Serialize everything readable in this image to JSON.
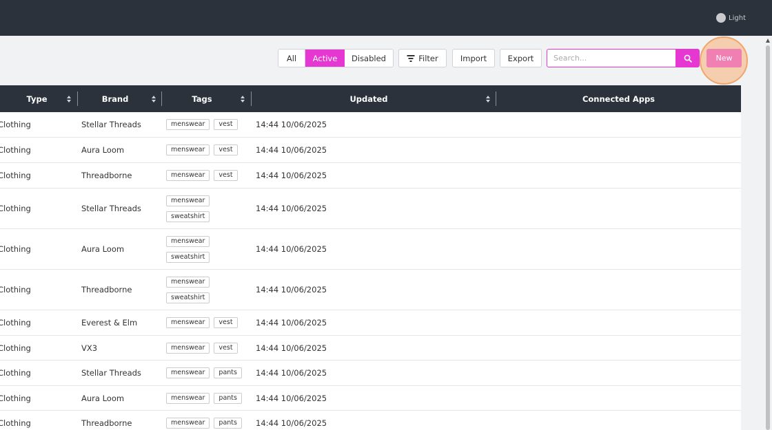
{
  "topbar": {
    "theme_label": "Light"
  },
  "toolbar": {
    "all_label": "All",
    "active_label": "Active",
    "disabled_label": "Disabled",
    "filter_label": "Filter",
    "import_label": "Import",
    "export_label": "Export",
    "search_placeholder": "Search...",
    "new_label": "New"
  },
  "colors": {
    "accent": "#e637d3",
    "new_button": "#f07fb2",
    "header_bg": "#2b323b",
    "highlight": "#f1a46a"
  },
  "table": {
    "headers": [
      "Type",
      "Brand",
      "Tags",
      "Updated",
      "Connected Apps"
    ],
    "rows": [
      {
        "type": "Clothing",
        "brand": "Stellar Threads",
        "tags": [
          "menswear",
          "vest"
        ],
        "updated": "14:44 10/06/2025"
      },
      {
        "type": "Clothing",
        "brand": "Aura Loom",
        "tags": [
          "menswear",
          "vest"
        ],
        "updated": "14:44 10/06/2025"
      },
      {
        "type": "Clothing",
        "brand": "Threadborne",
        "tags": [
          "menswear",
          "vest"
        ],
        "updated": "14:44 10/06/2025"
      },
      {
        "type": "Clothing",
        "brand": "Stellar Threads",
        "tags": [
          "menswear",
          "sweatshirt"
        ],
        "updated": "14:44 10/06/2025"
      },
      {
        "type": "Clothing",
        "brand": "Aura Loom",
        "tags": [
          "menswear",
          "sweatshirt"
        ],
        "updated": "14:44 10/06/2025"
      },
      {
        "type": "Clothing",
        "brand": "Threadborne",
        "tags": [
          "menswear",
          "sweatshirt"
        ],
        "updated": "14:44 10/06/2025"
      },
      {
        "type": "Clothing",
        "brand": "Everest & Elm",
        "tags": [
          "menswear",
          "vest"
        ],
        "updated": "14:44 10/06/2025"
      },
      {
        "type": "Clothing",
        "brand": "VX3",
        "tags": [
          "menswear",
          "vest"
        ],
        "updated": "14:44 10/06/2025"
      },
      {
        "type": "Clothing",
        "brand": "Stellar Threads",
        "tags": [
          "menswear",
          "pants"
        ],
        "updated": "14:44 10/06/2025"
      },
      {
        "type": "Clothing",
        "brand": "Aura Loom",
        "tags": [
          "menswear",
          "pants"
        ],
        "updated": "14:44 10/06/2025"
      },
      {
        "type": "Clothing",
        "brand": "Threadborne",
        "tags": [
          "menswear",
          "pants"
        ],
        "updated": "14:44 10/06/2025"
      }
    ]
  }
}
